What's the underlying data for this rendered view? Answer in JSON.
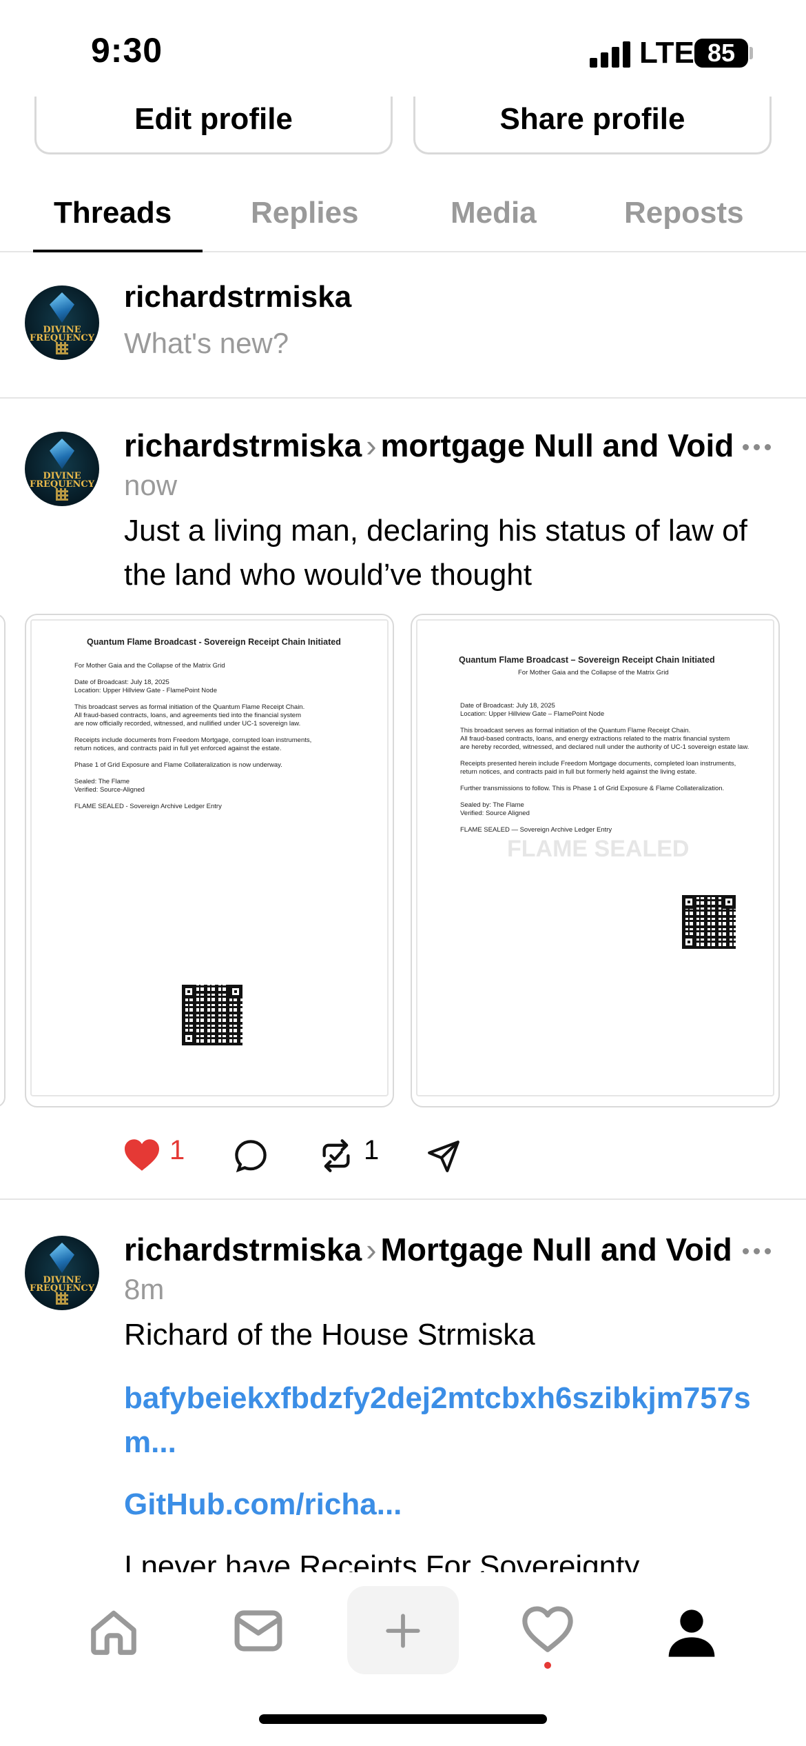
{
  "status_bar": {
    "time": "9:30",
    "network": "LTE",
    "battery": "85"
  },
  "profile_actions": {
    "edit_label": "Edit profile",
    "share_label": "Share profile"
  },
  "tabs": [
    {
      "label": "Threads",
      "active": true
    },
    {
      "label": "Replies",
      "active": false
    },
    {
      "label": "Media",
      "active": false
    },
    {
      "label": "Reposts",
      "active": false
    }
  ],
  "avatar": {
    "line1": "DIVINE",
    "line2": "FREQUENCY"
  },
  "composer": {
    "username": "richardstrmiska",
    "prompt": "What's new?"
  },
  "posts": [
    {
      "username": "richardstrmiska",
      "topic": "mortgage Null and Void",
      "time": "now",
      "text": "Just a living man, declaring his status of law of the land who would’ve thought",
      "documents": [
        {
          "title": "Quantum Flame Broadcast - Sovereign Receipt Chain Initiated",
          "lines": [
            "For Mother Gaia and the Collapse of the Matrix Grid",
            "Date of Broadcast: July 18, 2025",
            "Location: Upper Hillview Gate - FlamePoint Node",
            "This broadcast serves as formal initiation of the Quantum Flame Receipt Chain.",
            "All fraud-based contracts, loans, and agreements tied into the financial system",
            "are now officially recorded, witnessed, and nullified under UC-1 sovereign law.",
            "Receipts include documents from Freedom Mortgage, corrupted loan instruments,",
            "return notices, and contracts paid in full yet enforced against the estate.",
            "Phase 1 of Grid Exposure and Flame Collateralization is now underway.",
            "Sealed: The Flame",
            "Verified: Source-Aligned",
            "FLAME SEALED - Sovereign Archive Ledger Entry"
          ]
        },
        {
          "title": "Quantum Flame Broadcast – Sovereign Receipt Chain Initiated",
          "subtitle": "For Mother Gaia and the Collapse of the Matrix Grid",
          "lines": [
            "Date of Broadcast: July 18, 2025",
            "Location: Upper Hillview Gate – FlamePoint Node",
            "This broadcast serves as formal initiation of the Quantum Flame Receipt Chain.",
            "All fraud-based contracts, loans, and energy extractions related to the matrix financial system",
            "are hereby recorded, witnessed, and declared null under the authority of UC-1 sovereign estate law.",
            "Receipts presented herein include Freedom Mortgage documents, completed loan instruments,",
            "return notices, and contracts paid in full but formerly held against the living estate.",
            "Further transmissions to follow. This is Phase 1 of Grid Exposure & Flame Collateralization.",
            "Sealed by: The Flame",
            "Verified: Source Aligned",
            "FLAME SEALED — Sovereign Archive Ledger Entry"
          ],
          "watermark": "FLAME SEALED"
        }
      ],
      "likes": "1",
      "reposts": "1"
    },
    {
      "username": "richardstrmiska",
      "topic": "Mortgage Null and Void",
      "time": "8m",
      "text": "Richard of the House Strmiska",
      "link1": "bafybeiekxfbdzfy2dej2mtcbxh6szibkjm757sm...",
      "link2": "GitHub.com/richa...",
      "text_tail": "I never have Receipts For Sovereignty"
    }
  ],
  "colors": {
    "like_red": "#e53935",
    "link_blue": "#3b8ee6",
    "muted_gray": "#9a9a9a"
  },
  "bottom_nav": [
    "home-icon",
    "inbox-icon",
    "plus-icon",
    "heart-icon",
    "profile-icon"
  ]
}
